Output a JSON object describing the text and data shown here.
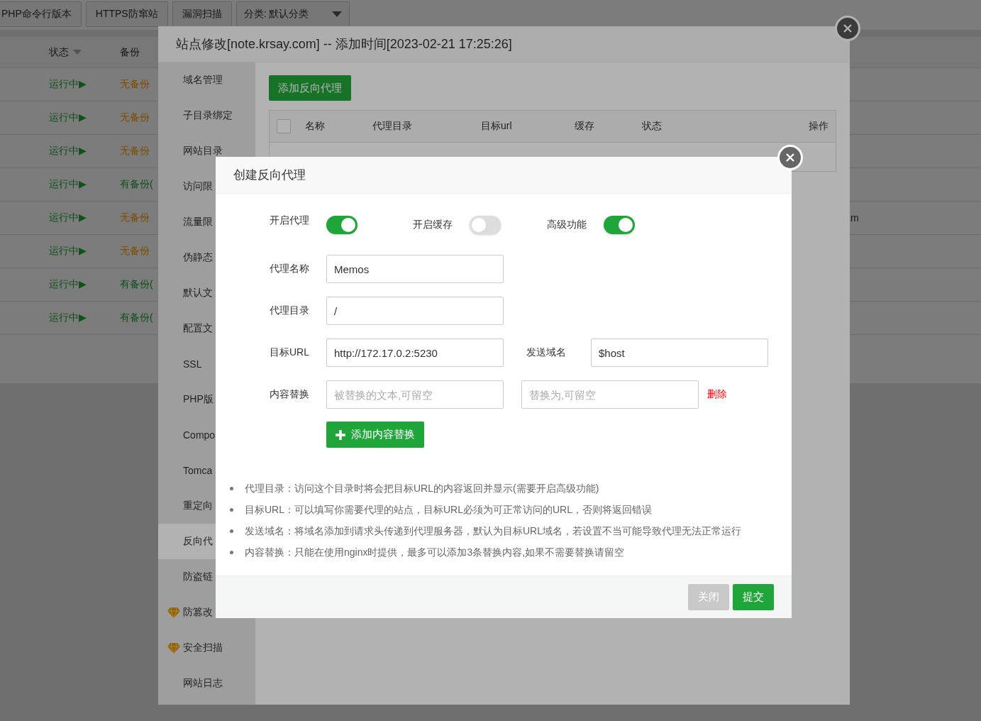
{
  "toolbar": {
    "buttons": [
      "PHP命令行版本",
      "HTTPS防窜站",
      "漏洞扫描"
    ],
    "category_select": "分类: 默认分类"
  },
  "site_table": {
    "columns": [
      "状态",
      "备份"
    ],
    "rows": [
      {
        "status": "运行中▶",
        "backup": "无备份",
        "kind": "none"
      },
      {
        "status": "运行中▶",
        "backup": "无备份",
        "kind": "none"
      },
      {
        "status": "运行中▶",
        "backup": "无备份",
        "kind": "none"
      },
      {
        "status": "运行中▶",
        "backup": "有备份(",
        "kind": "has"
      },
      {
        "status": "运行中▶",
        "backup": "无备份",
        "kind": "none",
        "column_3": "m"
      },
      {
        "status": "运行中▶",
        "backup": "无备份",
        "kind": "none"
      },
      {
        "status": "运行中▶",
        "backup": "有备份(",
        "kind": "has"
      },
      {
        "status": "运行中▶",
        "backup": "有备份(",
        "kind": "has"
      }
    ]
  },
  "site_dialog": {
    "title": "站点修改[note.krsay.com] -- 添加时间[2023-02-21 17:25:26]",
    "menu": [
      {
        "label": "域名管理",
        "selected": false,
        "kind": "plain"
      },
      {
        "label": "子目录绑定",
        "selected": false,
        "kind": "plain"
      },
      {
        "label": "网站目录",
        "selected": false,
        "kind": "plain"
      },
      {
        "label": "访问限",
        "selected": false,
        "kind": "plain"
      },
      {
        "label": "流量限",
        "selected": false,
        "kind": "plain"
      },
      {
        "label": "伪静态",
        "selected": false,
        "kind": "plain"
      },
      {
        "label": "默认文",
        "selected": false,
        "kind": "plain"
      },
      {
        "label": "配置文",
        "selected": false,
        "kind": "plain"
      },
      {
        "label": "SSL",
        "selected": false,
        "kind": "plain"
      },
      {
        "label": "PHP版",
        "selected": false,
        "kind": "plain"
      },
      {
        "label": "Compo",
        "selected": false,
        "kind": "plain"
      },
      {
        "label": "Tomca",
        "selected": false,
        "kind": "plain"
      },
      {
        "label": "重定向",
        "selected": false,
        "kind": "plain"
      },
      {
        "label": "反向代",
        "selected": true,
        "kind": "plain"
      },
      {
        "label": "防盗链",
        "selected": false,
        "kind": "plain"
      },
      {
        "label": "防篡改",
        "selected": false,
        "kind": "premium"
      },
      {
        "label": "安全扫描",
        "selected": false,
        "kind": "premium"
      },
      {
        "label": "网站日志",
        "selected": false,
        "kind": "plain"
      }
    ],
    "add_button": "添加反向代理",
    "table": {
      "select_all_checked": false,
      "columns": [
        "名称",
        "代理目录",
        "目标url",
        "缓存",
        "状态",
        "操作"
      ]
    }
  },
  "proxy_dialog": {
    "title": "创建反向代理",
    "toggles": [
      {
        "label": "开启代理",
        "on": true
      },
      {
        "label": "开启缓存",
        "on": false
      },
      {
        "label": "高级功能",
        "on": true
      }
    ],
    "proxy_name": {
      "label": "代理名称",
      "value": "Memos"
    },
    "proxy_dir": {
      "label": "代理目录",
      "value": "/"
    },
    "target_url": {
      "label": "目标URL",
      "value": "http://172.17.0.2:5230"
    },
    "send_domain": {
      "label": "发送域名",
      "value": "$host"
    },
    "replace": {
      "label": "内容替换",
      "from_placeholder": "被替换的文本,可留空",
      "to_placeholder": "替换为,可留空",
      "delete": "删除"
    },
    "add_replace_button": "添加内容替换",
    "notes": [
      "代理目录：访问这个目录时将会把目标URL的内容返回并显示(需要开启高级功能)",
      "目标URL：可以填写你需要代理的站点，目标URL必须为可正常访问的URL，否则将返回错误",
      "发送域名：将域名添加到请求头传递到代理服务器，默认为目标URL域名，若设置不当可能导致代理无法正常运行",
      "内容替换：只能在使用nginx时提供，最多可以添加3条替换内容,如果不需要替换请留空"
    ],
    "buttons": [
      {
        "label": "关闭",
        "kind": "secondary"
      },
      {
        "label": "提交",
        "kind": "primary"
      }
    ]
  }
}
